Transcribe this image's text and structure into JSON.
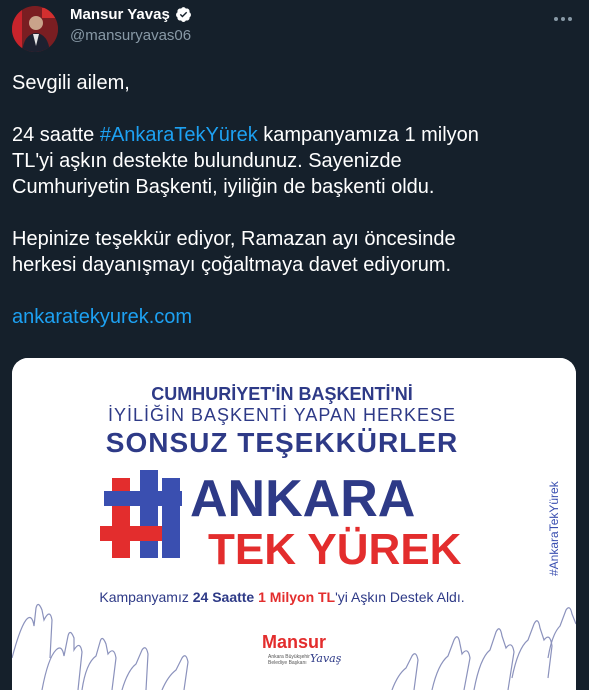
{
  "author": {
    "name": "Mansur Yavaş",
    "handle": "@mansuryavas06"
  },
  "tweet": {
    "line1": "Sevgili ailem,",
    "para2_a": "24 saatte ",
    "hashtag": "#AnkaraTekYürek",
    "para2_b": " kampanyamıza 1 milyon",
    "para2_line2": "TL'yi aşkın destekte bulundunuz. Sayenizde",
    "para2_line3": "Cumhuriyetin Başkenti, iyiliğin de başkenti oldu.",
    "para3_line1": "Hepinize teşekkür ediyor, Ramazan ayı öncesinde",
    "para3_line2": "herkesi dayanışmayı çoğaltmaya davet ediyorum.",
    "link": "ankaratekyurek.com"
  },
  "poster": {
    "headline1": "CUMHURİYET'İN BAŞKENTİ'Nİ",
    "headline2": "İYİLİĞİN BAŞKENTİ YAPAN HERKESE",
    "headline3": "SONSUZ TEŞEKKÜRLER",
    "logo_word1": "ANKARA",
    "logo_word2": "TEK YÜREK",
    "tagline_a": "Kampanyamız ",
    "tagline_b": "24 Saatte",
    "tagline_c": " ",
    "tagline_d": "1 Milyon TL",
    "tagline_e": "'yi Aşkın Destek Aldı.",
    "side_hashtag": "#AnkaraTekYürek",
    "signature_name": "Mansur",
    "signature_script": "Yavaş",
    "signature_small1": "Ankara Büyükşehir",
    "signature_small2": "Belediye Başkanı"
  },
  "colors": {
    "navy": "#2e3a87",
    "red": "#e32d2d",
    "blue": "#3a4fb0",
    "link": "#1da1f2",
    "bg": "#15202b"
  },
  "icons": [
    "verified-badge-icon",
    "more-options-icon"
  ]
}
